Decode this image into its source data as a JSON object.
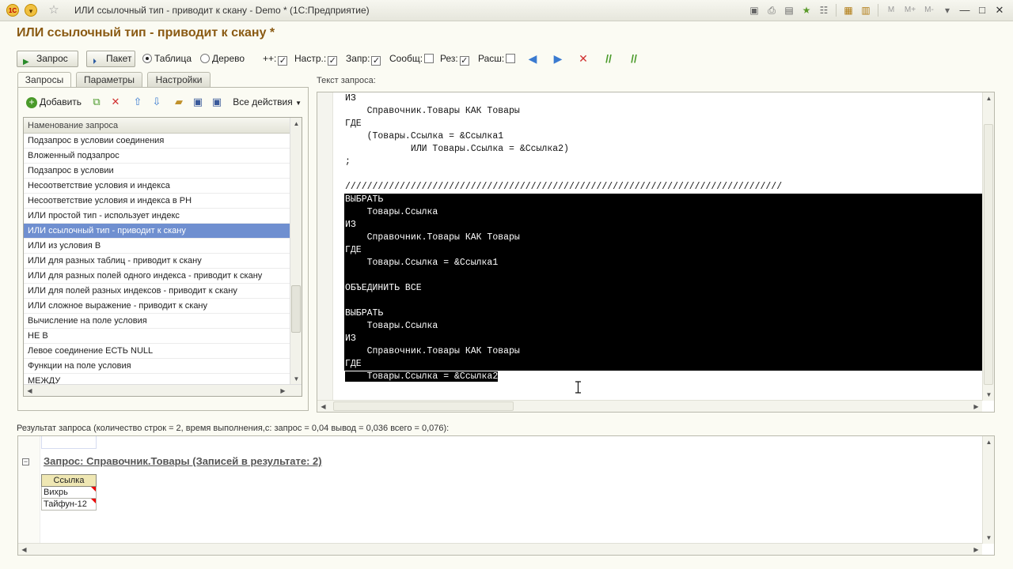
{
  "window": {
    "title": "ИЛИ ссылочный тип - приводит к скану - Demo * (1С:Предприятие)",
    "logo_icon": "1c-logo-icon",
    "right_buttons": [
      "M",
      "M+",
      "M-"
    ]
  },
  "form": {
    "title": "ИЛИ ссылочный тип - приводит к скану *"
  },
  "commandbar": {
    "query_btn": "Запрос",
    "batch_btn": "Пакет",
    "view_table": "Таблица",
    "view_tree": "Дерево",
    "view_selected": "table",
    "chk_plus": "++:",
    "chk_nastr": "Настр.:",
    "chk_zapr": "Запр:",
    "chk_soobsh": "Сообщ:",
    "chk_rez": "Рез:",
    "chk_rassh": "Расш:",
    "checks": {
      "plus": true,
      "nastr": true,
      "zapr": true,
      "soobsh": false,
      "rez": true,
      "rassh": false
    }
  },
  "left": {
    "tabs": [
      "Запросы",
      "Параметры",
      "Настройки"
    ],
    "active_tab": "Запросы",
    "toolbar": {
      "add": "Добавить",
      "all_actions": "Все действия"
    },
    "list_header": "Наменование запроса",
    "items": [
      "Подзапрос в условии соединения",
      "Вложенный подзапрос",
      "Подзапрос в условии",
      "Несоответствие условия и индекса",
      "Несоответствие условия и индекса в РН",
      "ИЛИ простой тип - использует индекс",
      "ИЛИ ссылочный тип - приводит к скану",
      "ИЛИ из условия В",
      "ИЛИ для разных таблиц - приводит к скану",
      "ИЛИ для разных полей одного индекса - приводит к скану",
      "ИЛИ для полей разных индексов - приводит к скану",
      "ИЛИ сложное выражение - приводит к скану",
      "Вычисление на поле условия",
      "НЕ В",
      "Левое соединение ЕСТЬ NULL",
      "Функции на поле условия",
      "МЕЖДУ"
    ],
    "selected_index": 6
  },
  "editor": {
    "label": "Текст запроса:",
    "lines": [
      "ИЗ",
      "    Справочник.Товары КАК Товары",
      "ГДЕ",
      "    (Товары.Ссылка = &Ссылка1",
      "            ИЛИ Товары.Ссылка = &Ссылка2)",
      ";",
      "",
      "////////////////////////////////////////////////////////////////////////////////",
      "ВЫБРАТЬ",
      "    Товары.Ссылка",
      "ИЗ",
      "    Справочник.Товары КАК Товары",
      "ГДЕ",
      "    Товары.Ссылка = &Ссылка1",
      "",
      "ОБЪЕДИНИТЬ ВСЕ",
      "",
      "ВЫБРАТЬ",
      "    Товары.Ссылка",
      "ИЗ",
      "    Справочник.Товары КАК Товары",
      "ГДЕ",
      "    Товары.Ссылка = &Ссылка2"
    ],
    "highlight_from": 8,
    "highlight_to": 21,
    "partial_highlight_line": 22
  },
  "result": {
    "label": "Результат запроса (количество строк = 2, время выполнения,с: запрос = 0,04  вывод = 0,036  всего = 0,076):",
    "section_title": "Запрос: Справочник.Товары (Записей в результате: 2)",
    "column": "Ссылка",
    "rows": [
      "Вихрь",
      "Тайфун-12"
    ]
  }
}
